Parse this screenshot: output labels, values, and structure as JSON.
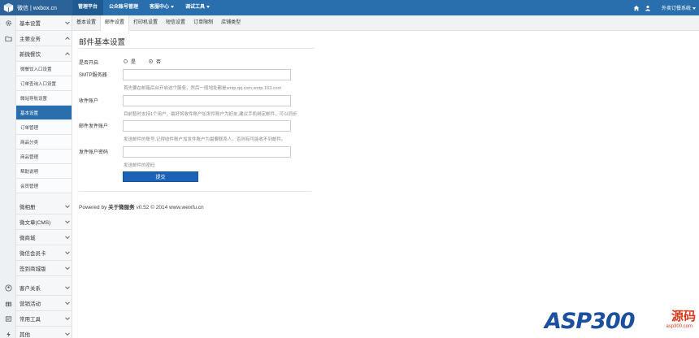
{
  "topbar": {
    "brand": "微信 | wxbox.cn",
    "nav": [
      {
        "label": "管理平台",
        "active": true,
        "dropdown": false
      },
      {
        "label": "公众账号管理",
        "active": false,
        "dropdown": false
      },
      {
        "label": "客服中心",
        "active": false,
        "dropdown": true
      },
      {
        "label": "调试工具",
        "active": false,
        "dropdown": true
      }
    ],
    "user": "外卖订餐系统"
  },
  "sidebar": {
    "groups_top": [
      {
        "label": "基本设置",
        "icon": "gear-icon"
      },
      {
        "label": "主要业务",
        "icon": "folder-icon"
      }
    ],
    "main_items": [
      {
        "label": "新微餐饮"
      },
      {
        "label": "微餐饮入口设置"
      },
      {
        "label": "订单查询入口设置"
      },
      {
        "label": "微站导航设置"
      },
      {
        "label": "基本设置"
      },
      {
        "label": "订单管理"
      },
      {
        "label": "商品分类"
      },
      {
        "label": "商品管理"
      },
      {
        "label": "帮助说明"
      },
      {
        "label": "会员管理"
      }
    ],
    "more_items": [
      {
        "label": "微相册"
      },
      {
        "label": "微文章(CMS)"
      },
      {
        "label": "微商城"
      },
      {
        "label": "微信会员卡"
      },
      {
        "label": "签到商城版"
      }
    ],
    "groups_bottom": [
      {
        "label": "客户关系",
        "icon": "user-icon"
      },
      {
        "label": "营销活动",
        "icon": "gift-icon"
      },
      {
        "label": "常用工具",
        "icon": "tools-icon"
      },
      {
        "label": "其他",
        "icon": "bolt-icon"
      }
    ]
  },
  "subtabs": [
    {
      "label": "基本设置",
      "active": false
    },
    {
      "label": "邮件设置",
      "active": true
    },
    {
      "label": "打印机设置",
      "active": false
    },
    {
      "label": "短信设置",
      "active": false
    },
    {
      "label": "订单限制",
      "active": false
    },
    {
      "label": "店铺类型",
      "active": false
    }
  ],
  "main": {
    "title": "邮件基本设置",
    "enabled": {
      "label": "是否开启",
      "yes": "是",
      "no": "否",
      "selected": "no"
    },
    "smtp": {
      "label": "SMTP服务器",
      "value": "",
      "help": "首先要在邮箱后台开启这个服务，然后一般地址都是smtp.qq.com,smtp.163.com"
    },
    "recipient": {
      "label": "收件账户",
      "value": "",
      "help": "目前暂时支持1个用户，最好将收件账户加发件账户为好友,建议手机绑定邮件，可以同步"
    },
    "sender": {
      "label": "邮件发件账户",
      "value": "",
      "help": "发送邮件的账号,记得收件账户加发件账户为最要联系人，否则有可能收不到邮件。"
    },
    "password": {
      "label": "发件账户密码",
      "value": "",
      "help": "发送邮件的密码"
    },
    "submit": "提交",
    "footer": {
      "prefix": "Powered by ",
      "link": "关于微服务",
      "suffix": " v0.52 © 2014 www.weixfu.cn"
    }
  },
  "watermark": {
    "text": "ASP300",
    "cn": "源码",
    "url": "asp300.com"
  },
  "colors": {
    "topbar": "#2a6fad",
    "accent": "#1c63b8",
    "sidebar_bg": "#f5f7f9"
  }
}
